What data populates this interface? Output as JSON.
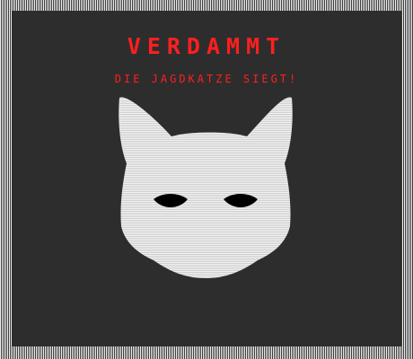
{
  "screen": {
    "title": "VERDAMMT",
    "subtitle": "DIE JAGDKATZE SIEGT!"
  },
  "colors": {
    "background": "#2d2d2d",
    "text_red": "#ff1f1f",
    "cat_white": "#f2f2f2",
    "eye_black": "#000000"
  },
  "icons": {
    "cat": "cat-head-icon"
  }
}
